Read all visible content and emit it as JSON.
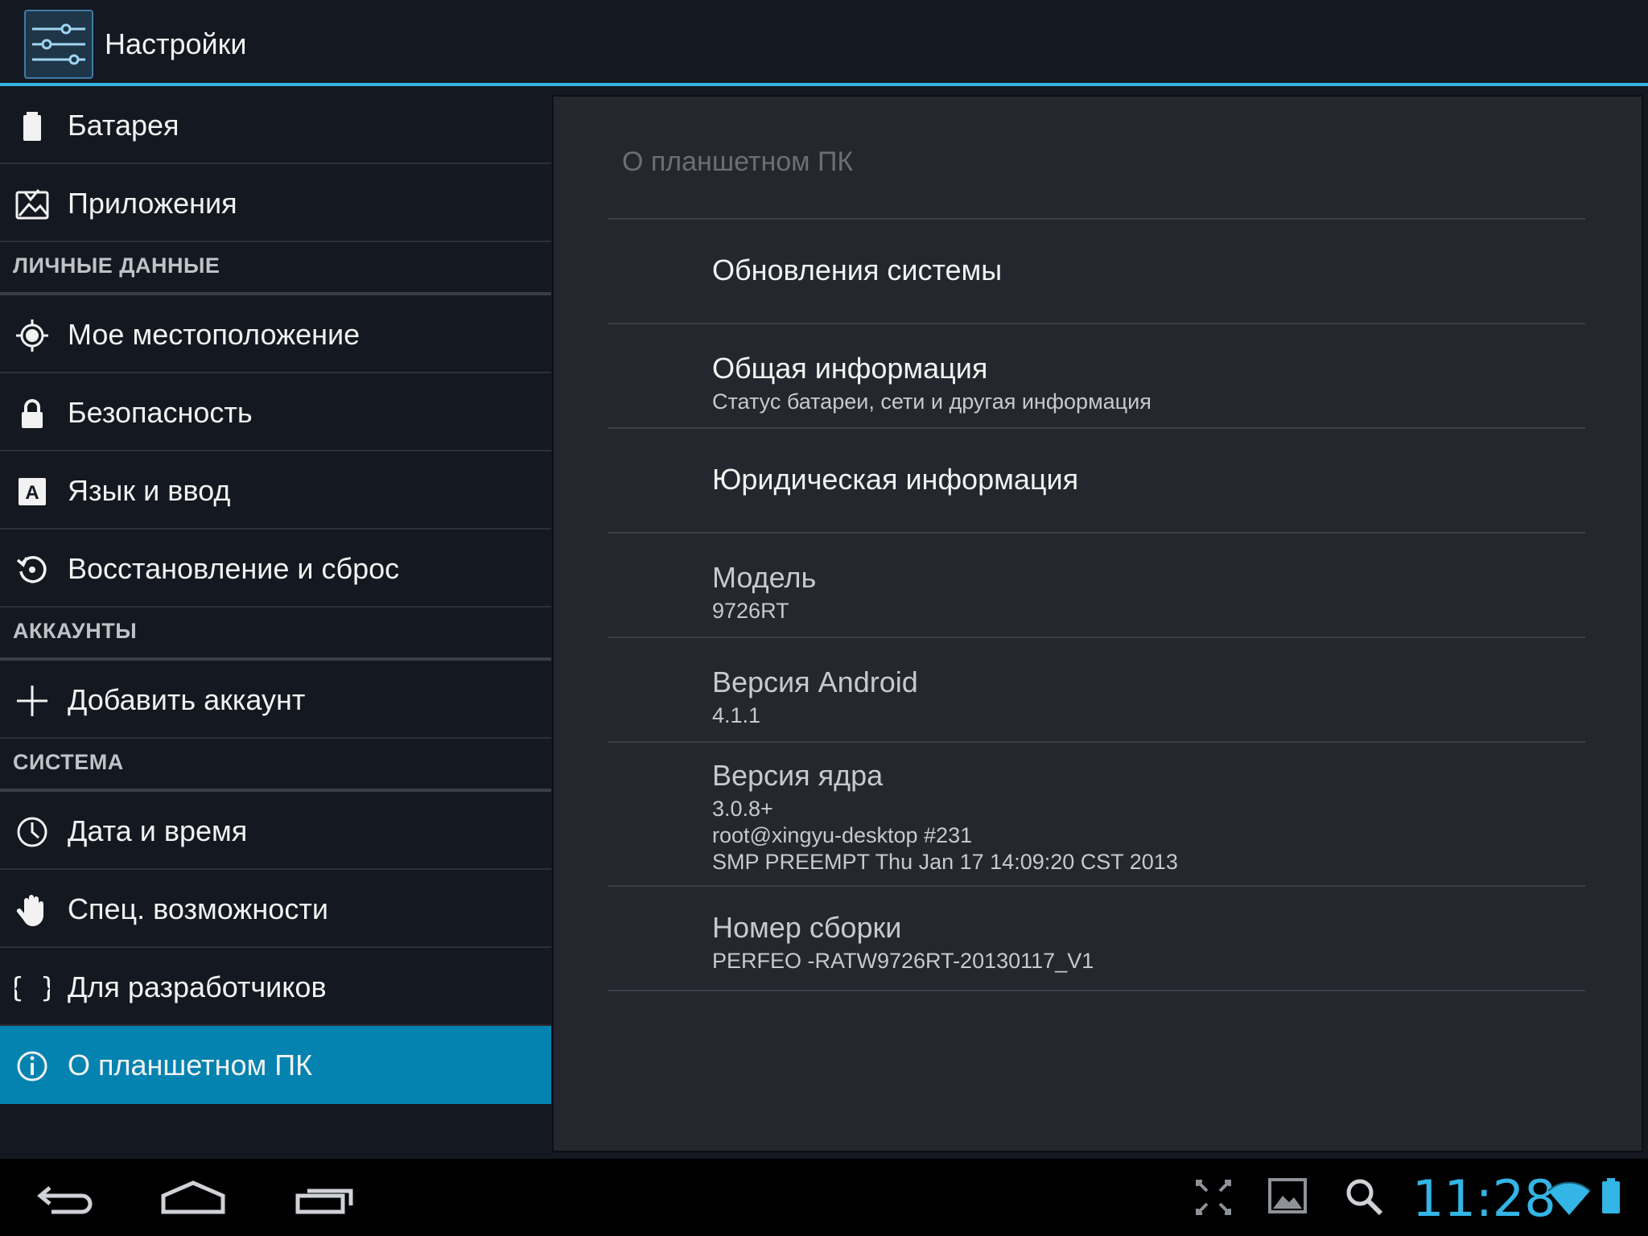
{
  "actionbar": {
    "title": "Настройки",
    "icon": "settings-sliders-icon"
  },
  "sidebar": {
    "items": [
      {
        "kind": "item",
        "label": "Батарея",
        "icon": "battery-icon"
      },
      {
        "kind": "item",
        "label": "Приложения",
        "icon": "apps-icon"
      },
      {
        "kind": "section",
        "label": "ЛИЧНЫЕ ДАННЫЕ"
      },
      {
        "kind": "item",
        "label": "Мое местоположение",
        "icon": "location-icon"
      },
      {
        "kind": "item",
        "label": "Безопасность",
        "icon": "lock-icon"
      },
      {
        "kind": "item",
        "label": "Язык и ввод",
        "icon": "keyboard-language-icon"
      },
      {
        "kind": "item",
        "label": "Восстановление и сброс",
        "icon": "restore-icon"
      },
      {
        "kind": "section",
        "label": "АККАУНТЫ"
      },
      {
        "kind": "item",
        "label": "Добавить аккаунт",
        "icon": "plus-icon"
      },
      {
        "kind": "section",
        "label": "СИСТЕМА"
      },
      {
        "kind": "item",
        "label": "Дата и время",
        "icon": "clock-icon"
      },
      {
        "kind": "item",
        "label": "Спец. возможности",
        "icon": "hand-icon"
      },
      {
        "kind": "item",
        "label": "Для разработчиков",
        "icon": "braces-icon"
      },
      {
        "kind": "item",
        "label": "О планшетном ПК",
        "icon": "info-icon",
        "selected": true
      }
    ]
  },
  "detail": {
    "header": "О планшетном ПК",
    "prefs": [
      {
        "title": "Обновления системы"
      },
      {
        "title": "Общая информация",
        "summary": "Статус батареи, сети и другая информация"
      },
      {
        "title": "Юридическая информация"
      },
      {
        "title": "Модель",
        "summary": "9726RT"
      },
      {
        "title": "Версия Android",
        "summary": "4.1.1"
      },
      {
        "title": "Версия ядра",
        "summary_lines": [
          "3.0.8+",
          "root@xingyu-desktop #231",
          "SMP PREEMPT Thu Jan 17 14:09:20 CST 2013"
        ]
      },
      {
        "title": "Номер сборки",
        "summary": "PERFEO -RATW9726RT-20130117_V1"
      }
    ]
  },
  "navbar": {
    "buttons": [
      "back-icon",
      "home-icon",
      "recents-icon"
    ],
    "status_icons": [
      "fullscreen-icon",
      "gallery-icon",
      "search-icon",
      "wifi-icon",
      "battery-status-icon"
    ],
    "time": "11:28",
    "accent": "#33b5e5"
  },
  "colors": {
    "accent": "#33b5e5",
    "selected": "#0483b1",
    "background": "#141820",
    "pane": "#24272d"
  }
}
